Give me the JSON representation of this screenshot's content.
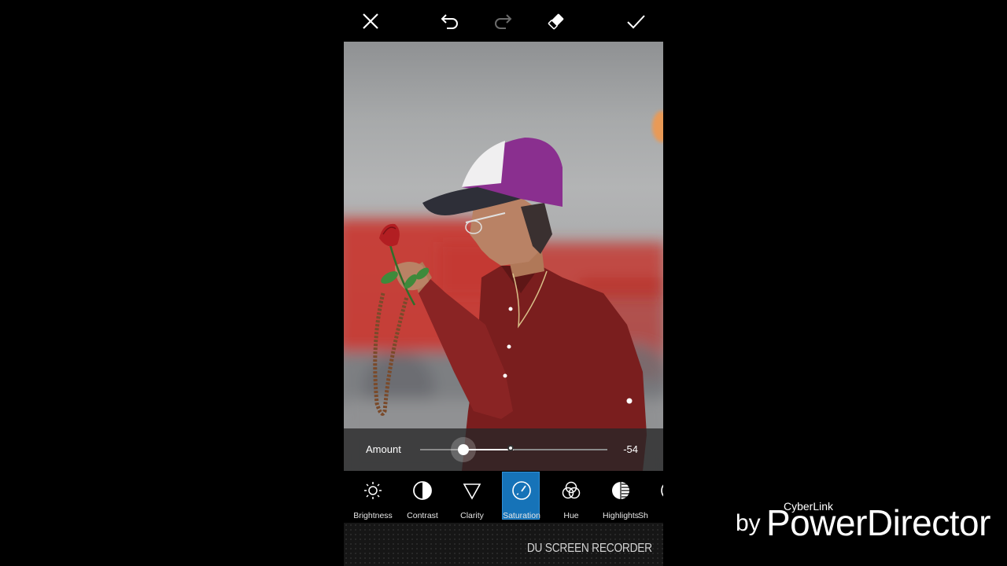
{
  "toolbar": {
    "close": "close-icon",
    "undo": "undo-icon",
    "redo": "redo-icon",
    "eraser": "eraser-icon",
    "apply": "check-icon"
  },
  "amount": {
    "label": "Amount",
    "value": "-54",
    "level": -54,
    "range": [
      -100,
      100
    ]
  },
  "tools": [
    {
      "label": "Brightness",
      "icon": "sun-icon"
    },
    {
      "label": "Contrast",
      "icon": "contrast-icon"
    },
    {
      "label": "Clarity",
      "icon": "triangle-icon"
    },
    {
      "label": "Saturation",
      "icon": "gauge-icon",
      "selected": true
    },
    {
      "label": "Hue",
      "icon": "rgb-circles-icon"
    },
    {
      "label": "Highlights",
      "icon": "highlights-icon"
    },
    {
      "label": "Sh",
      "icon": "shadows-icon"
    }
  ],
  "recorder_text": "DU SCREEN RECORDER",
  "watermark": {
    "by": "by",
    "company": "CyberLink",
    "product": "PowerDirector"
  },
  "colors": {
    "accent": "#1673b8",
    "background": "#000000"
  }
}
